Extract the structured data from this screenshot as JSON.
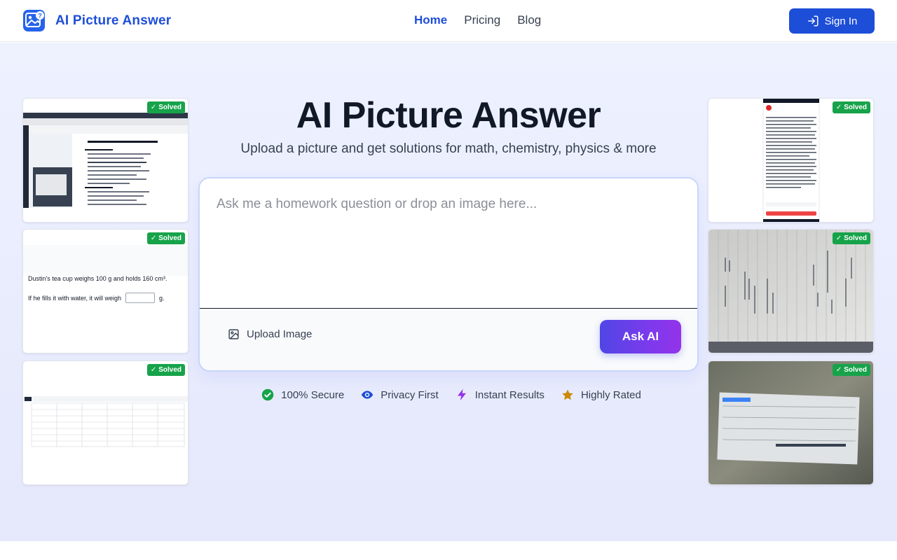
{
  "header": {
    "brand_name": "AI Picture Answer",
    "nav": [
      "Home",
      "Pricing",
      "Blog"
    ],
    "active_nav": "Home",
    "signin_label": "Sign In"
  },
  "hero": {
    "title": "AI Picture Answer",
    "subtitle": "Upload a picture and get solutions for math, chemistry, physics & more",
    "input_placeholder": "Ask me a homework question or drop an image here...",
    "upload_label": "Upload Image",
    "ask_label": "Ask AI"
  },
  "badge_label": "Solved",
  "example_cards": {
    "card2_line1": "Dustin's tea cup weighs 100 g and holds 160 cm³.",
    "card2_line2_prefix": "If he fills it with water, it will weigh",
    "card2_line2_suffix": "g."
  },
  "features": [
    {
      "label": "100% Secure",
      "icon": "check-circle-icon",
      "color": "#16a34a"
    },
    {
      "label": "Privacy First",
      "icon": "eye-icon",
      "color": "#1d4ed8"
    },
    {
      "label": "Instant Results",
      "icon": "lightning-icon",
      "color": "#9333ea"
    },
    {
      "label": "Highly Rated",
      "icon": "star-icon",
      "color": "#ca8a04"
    }
  ],
  "colors": {
    "brand": "#1d4ed8",
    "solved_badge": "#16a34a",
    "ask_gradient_start": "#4f46e5",
    "ask_gradient_end": "#9333ea"
  }
}
